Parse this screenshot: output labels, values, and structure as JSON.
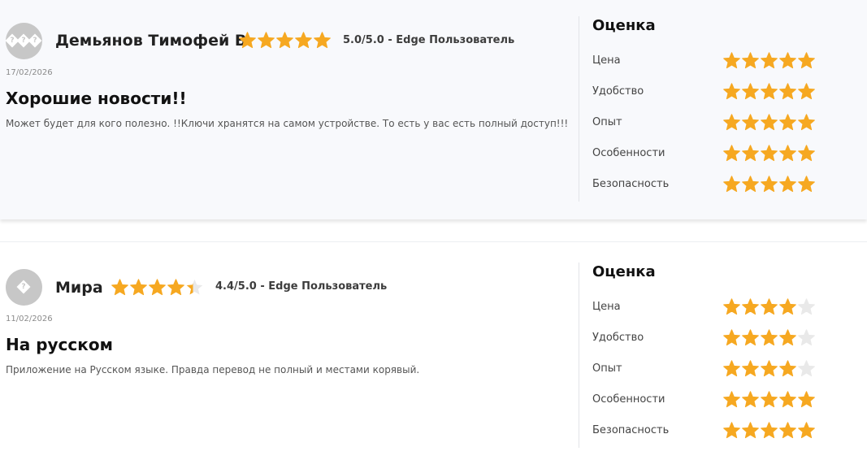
{
  "colors": {
    "star_filled": "#f6a821",
    "star_empty": "#e9e9e9",
    "avatar_bg": "#c7c7c7"
  },
  "reviews": [
    {
      "author": "Демьянов Тимофей В.",
      "avatar_icon": "question-diamond-icon",
      "avatar_glyph": "?",
      "rating": 5.0,
      "score_text": "5.0/5.0 - Edge Пользователь",
      "date": "17/02/2026",
      "title": "Хорошие новости!!",
      "text": "Может будет для кого полезно. !!Ключи хранятся на самом устройстве. То есть у вас есть полный доступ!!!",
      "rating_heading": "Оценка",
      "criteria": [
        {
          "label": "Цена",
          "rating": 5
        },
        {
          "label": "Удобство",
          "rating": 5
        },
        {
          "label": "Опыт",
          "rating": 5
        },
        {
          "label": "Особенности",
          "rating": 5
        },
        {
          "label": "Безопасность",
          "rating": 5
        }
      ]
    },
    {
      "author": "Мира",
      "avatar_icon": "question-diamond-icon",
      "avatar_glyph": "?",
      "rating": 4.4,
      "score_text": "4.4/5.0 - Edge Пользователь",
      "date": "11/02/2026",
      "title": "На русском",
      "text": "Приложение на Русском языке. Правда перевод не полный и местами корявый.",
      "rating_heading": "Оценка",
      "criteria": [
        {
          "label": "Цена",
          "rating": 4
        },
        {
          "label": "Удобство",
          "rating": 4
        },
        {
          "label": "Опыт",
          "rating": 4
        },
        {
          "label": "Особенности",
          "rating": 5
        },
        {
          "label": "Безопасность",
          "rating": 5
        }
      ]
    }
  ]
}
